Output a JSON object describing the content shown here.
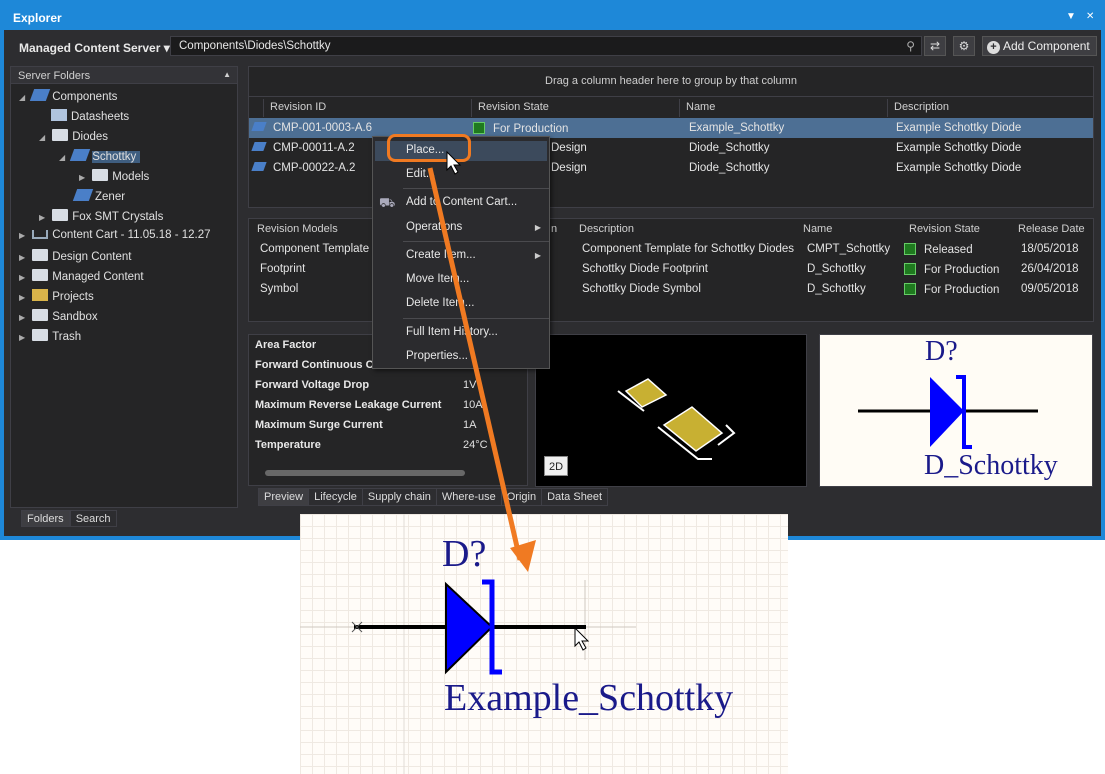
{
  "window": {
    "title": "Explorer",
    "pin_glyph": "▼",
    "close_glyph": "✕"
  },
  "toolbar": {
    "server": "Managed Content Server ▾",
    "path": "Components\\Diodes\\Schottky",
    "add_label": "Add Component",
    "add_glyph": "+",
    "refresh_glyph": "⇄",
    "settings_glyph": "⚙",
    "search_glyph": "⚲"
  },
  "sidebar": {
    "header": "Server Folders",
    "header_glyph": "▲",
    "items": [
      {
        "label": "Components",
        "twisty": "◢"
      },
      {
        "label": "Datasheets"
      },
      {
        "label": "Diodes",
        "twisty": "◢"
      },
      {
        "label": "Schottky",
        "twisty": "◢"
      },
      {
        "label": "Models",
        "twisty": "▶"
      },
      {
        "label": "Zener"
      },
      {
        "label": "Fox SMT Crystals",
        "twisty": "▶"
      },
      {
        "label": "Content Cart - 11.05.18 - 12.27",
        "twisty": "▶"
      },
      {
        "label": "Design Content",
        "twisty": "▶"
      },
      {
        "label": "Managed Content",
        "twisty": "▶"
      },
      {
        "label": "Projects",
        "twisty": "▶"
      },
      {
        "label": "Sandbox",
        "twisty": "▶"
      },
      {
        "label": "Trash",
        "twisty": "▶"
      }
    ],
    "tabs": [
      "Folders",
      "Search"
    ]
  },
  "grid1": {
    "hint": "Drag a column header here to group by that column",
    "columns": [
      "Revision ID",
      "Revision State",
      "Name",
      "Description"
    ],
    "rows": [
      {
        "id": "CMP-001-0003-A.6",
        "state": "For Production",
        "name": "Example_Schottky",
        "desc": "Example Schottky Diode"
      },
      {
        "id": "CMP-00011-A.2",
        "state": "Design",
        "name": "Diode_Schottky",
        "desc": "Example Schottky Diode"
      },
      {
        "id": "CMP-00022-A.2",
        "state": "Design",
        "name": "Diode_Schottky",
        "desc": "Example Schottky Diode"
      }
    ]
  },
  "grid2": {
    "columns": [
      "Revision Models",
      "n",
      "Description",
      "Name",
      "Revision State",
      "Release Date"
    ],
    "rows": [
      {
        "model": "Component Template",
        "desc": "Component Template for Schottky Diodes",
        "name": "CMPT_Schottky",
        "state": "Released",
        "date": "18/05/2018"
      },
      {
        "model": "Footprint",
        "desc": "Schottky Diode Footprint",
        "name": "D_Schottky",
        "state": "For Production",
        "date": "26/04/2018"
      },
      {
        "model": "Symbol",
        "desc": "Schottky Diode Symbol",
        "name": "D_Schottky",
        "state": "For Production",
        "date": "09/05/2018"
      }
    ]
  },
  "properties": [
    {
      "label": "Area Factor",
      "value": ""
    },
    {
      "label": "Forward Continuous C",
      "value": ""
    },
    {
      "label": "Forward Voltage Drop",
      "value": "1V"
    },
    {
      "label": "Maximum Reverse Leakage Current",
      "value": "10A"
    },
    {
      "label": "Maximum Surge Current",
      "value": "1A"
    },
    {
      "label": "Temperature",
      "value": "24°C"
    }
  ],
  "preview": {
    "btn_2d": "2D",
    "tabs": [
      "Preview",
      "Lifecycle",
      "Supply chain",
      "Where-use",
      "Origin",
      "Data Sheet"
    ],
    "designator": "D?",
    "symbol_name": "D_Schottky"
  },
  "menu": {
    "items": [
      "Place...",
      "Edit...",
      "Add to Content Cart...",
      "Operations",
      "Create Item...",
      "Move Item...",
      "Delete Item...",
      "Full Item History...",
      "Properties..."
    ],
    "submenu_glyph": "▶"
  },
  "canvas": {
    "designator": "D?",
    "name": "Example_Schottky"
  },
  "colors": {
    "accent": "#1e88d8",
    "callout": "#f07a22",
    "symbol": "#0000ff",
    "text_blue": "#1a1a8a",
    "state_green": "#1f7a1f"
  }
}
